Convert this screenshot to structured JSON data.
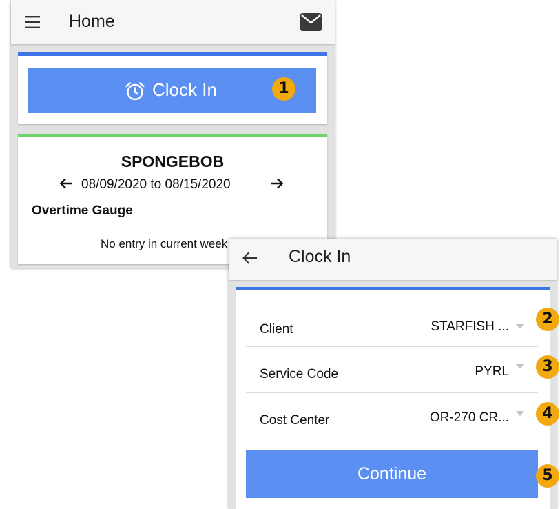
{
  "home": {
    "title": "Home",
    "menu_icon": "hamburger-menu-icon",
    "mail_icon": "envelope-icon",
    "clock_in_button": {
      "label": "Clock In",
      "icon": "alarm-clock-icon"
    },
    "employee_name": "SPONGEBOB",
    "date_range": "08/09/2020 to 08/15/2020",
    "prev_icon": "arrow-left-icon",
    "next_icon": "arrow-right-icon",
    "gauge_title": "Overtime Gauge",
    "no_entry_text": "No entry in current week"
  },
  "clock_in": {
    "title": "Clock In",
    "back_icon": "arrow-back-icon",
    "fields": [
      {
        "label": "Client",
        "value": "STARFISH ..."
      },
      {
        "label": "Service Code",
        "value": "PYRL"
      },
      {
        "label": "Cost Center",
        "value": "OR-270 CR..."
      }
    ],
    "continue_label": "Continue"
  },
  "badges": [
    "1",
    "2",
    "3",
    "4",
    "5"
  ],
  "colors": {
    "accent_blue": "#3f74e9",
    "button_blue": "#5b8ff2",
    "accent_green": "#6fd36b",
    "badge_orange": "#f1a90f"
  }
}
